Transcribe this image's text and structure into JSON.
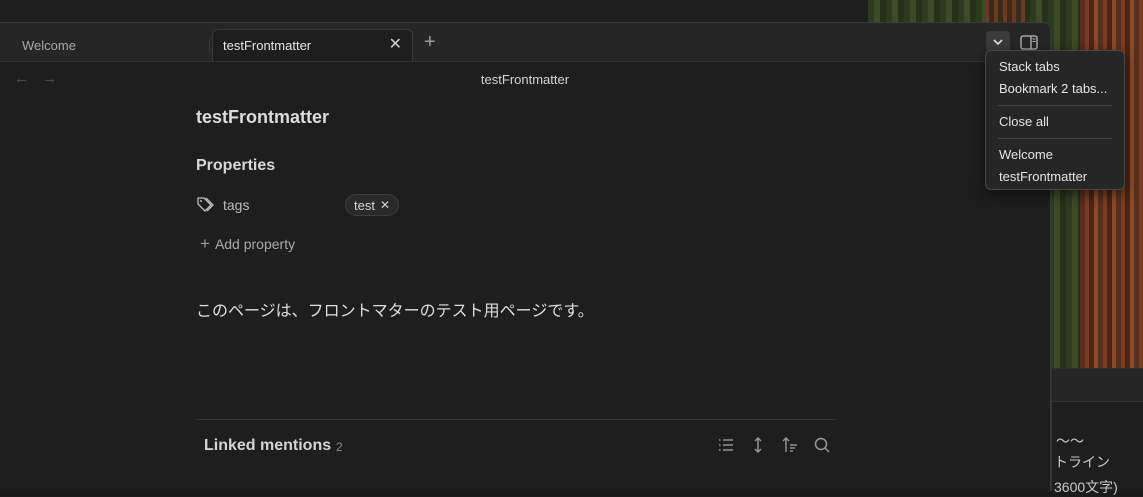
{
  "tabs": [
    {
      "label": "Welcome",
      "active": false
    },
    {
      "label": "testFrontmatter",
      "active": true
    }
  ],
  "tab_close_glyph": "✕",
  "new_tab_glyph": "+",
  "nav": {
    "back_icon": "arrow-left-icon",
    "forward_icon": "arrow-right-icon"
  },
  "view_header_title": "testFrontmatter",
  "note": {
    "title": "testFrontmatter",
    "properties_heading": "Properties",
    "properties": [
      {
        "icon": "tags-icon",
        "key": "tags",
        "values": [
          "test"
        ]
      }
    ],
    "add_property_label": "Add property",
    "body": "このページは、フロントマターのテスト用ページです。"
  },
  "backlinks": {
    "label": "Linked mentions",
    "count": "2",
    "icons": [
      "list-icon",
      "expand-collapse-icon",
      "sort-icon",
      "search-icon"
    ]
  },
  "tab_menu": {
    "items_group1": [
      "Stack tabs",
      "Bookmark 2 tabs..."
    ],
    "items_group2": [
      "Close all"
    ],
    "items_group3": [
      "Welcome",
      "testFrontmatter"
    ]
  },
  "background_window": {
    "lines": [
      "〜〜",
      "トライン",
      "3600文字)"
    ]
  },
  "colors": {
    "background": "#1e1e1e",
    "tabbar": "#262626",
    "text": "#dadada"
  }
}
